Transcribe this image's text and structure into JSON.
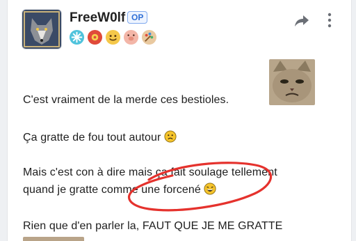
{
  "post": {
    "username": "FreeW0lf",
    "op_badge": "OP",
    "badges": [
      "snowflake-badge",
      "red-gear-badge",
      "smiley-badge",
      "pig-badge",
      "palette-badge"
    ],
    "lines": [
      "C'est vraiment de la merde ces bestioles.",
      "Ça gratte de fou tout autour",
      "Mais c'est con à dire mais ça fait soulage tellement",
      "quand je gratte comme une forcené",
      "Rien que d'en parler la, FAUT QUE JE ME GRATTE"
    ]
  },
  "colors": {
    "accent": "#2f6fd6",
    "scribble": "#e5322d"
  }
}
